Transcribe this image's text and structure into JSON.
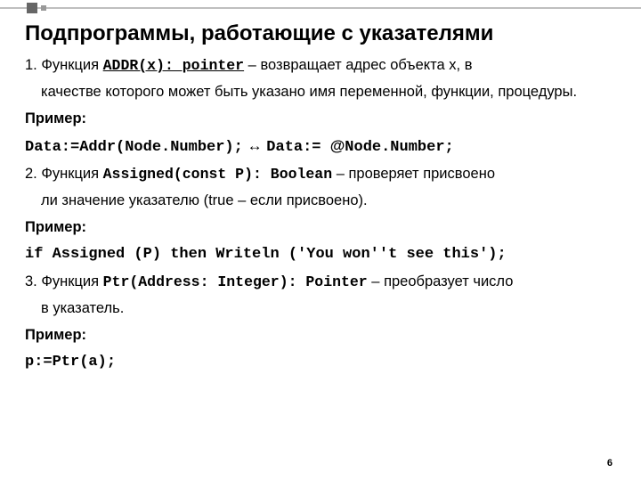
{
  "title": "Подпрограммы, работающие с указателями",
  "item1": {
    "lead": "1. Функция ",
    "fn": "ADDR(x): pointer",
    "tail1": " – возвращает адрес объекта х, в",
    "tail2": "качестве которого может быть указано имя переменной, функции, процедуры."
  },
  "example_label": "Пример:",
  "code1_left": "Data:=Addr(Node.Number);",
  "code1_arrow": " ↔ ",
  "code1_right_a": "Data:= ",
  "code1_right_at": "@",
  "code1_right_b": "Node.Number;",
  "item2": {
    "lead": "2. Функция ",
    "fn": "Assigned(const P): Boolean",
    "tail1": " – проверяет присвоено",
    "tail2": "ли значение указателю (true – если присвоено)."
  },
  "code2": "if Assigned (P) then Writeln ('You won''t see this');",
  "item3": {
    "lead": "3. Функция ",
    "fn": "Ptr(Address: Integer): Pointer",
    "tail1": " – преобразует число",
    "tail2": "в указатель."
  },
  "code3": "p:=Ptr(a);",
  "page": "6"
}
